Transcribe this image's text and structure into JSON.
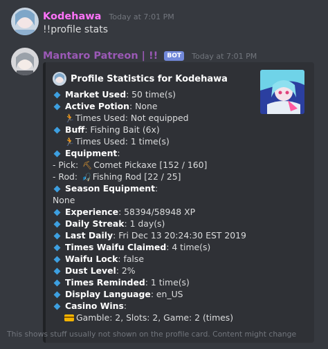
{
  "msg1": {
    "username": "Kodehawa",
    "username_color": "#ff73fa",
    "timestamp": "Today at 7:01 PM",
    "text": "!!profile stats"
  },
  "msg2": {
    "username": "Mantaro Patreon | !!",
    "username_color": "#9b59b6",
    "bot_tag": "BOT",
    "timestamp": "Today at 7:01 PM",
    "embed": {
      "author": "Profile Statistics for Kodehawa",
      "fields": {
        "market_used": {
          "label": "Market Used",
          "value": ": 50 time(s)"
        },
        "active_potion": {
          "label": "Active Potion",
          "value": ": None"
        },
        "potion_times": "Times Used: Not equipped",
        "buff": {
          "label": "Buff",
          "value": ": Fishing Bait (6x)"
        },
        "buff_times": "Times Used: 1 time(s)",
        "equipment": {
          "label": "Equipment",
          "value": ":"
        },
        "pick_prefix": "- Pick: ",
        "pick": "Comet Pickaxe [152 / 160]",
        "rod_prefix": "- Rod: ",
        "rod": "Fishing Rod [22 / 25]",
        "season_equipment": {
          "label": "Season Equipment",
          "value": ":"
        },
        "season_none": "None",
        "experience": {
          "label": "Experience",
          "value": ": 58394/58948 XP"
        },
        "daily_streak": {
          "label": "Daily Streak",
          "value": ": 1 day(s)"
        },
        "last_daily": {
          "label": "Last Daily",
          "value": ": Fri Dec 13 20:24:30 EST 2019"
        },
        "waifu_claimed": {
          "label": "Times Waifu Claimed",
          "value": ": 4 time(s)"
        },
        "waifu_lock": {
          "label": "Waifu Lock",
          "value": ": false"
        },
        "dust_level": {
          "label": "Dust Level",
          "value": ": 2%"
        },
        "times_reminded": {
          "label": "Times Reminded",
          "value": ": 1 time(s)"
        },
        "display_language": {
          "label": "Display Language",
          "value": ": en_US"
        },
        "casino_wins": {
          "label": "Casino Wins",
          "value": ":"
        },
        "casino_detail": "Gamble: 2, Slots: 2, Game: 2 (times)"
      },
      "footer": "This shows stuff usually not shown on the profile card. Content might change"
    }
  }
}
